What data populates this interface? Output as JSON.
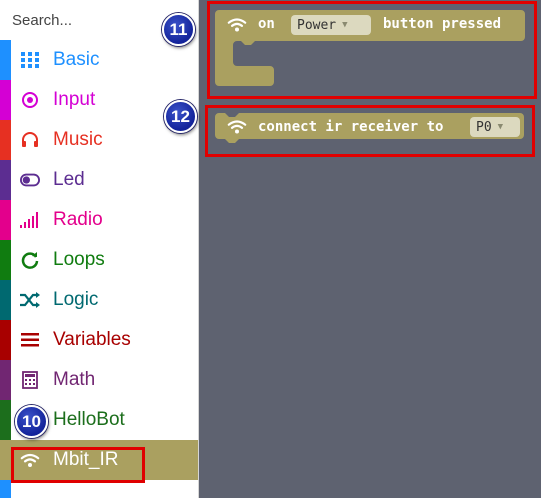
{
  "search": {
    "placeholder": "Search..."
  },
  "categories": [
    {
      "label": "Basic",
      "color": "#1e90ff",
      "icon": "grid-icon"
    },
    {
      "label": "Input",
      "color": "#d400d4",
      "icon": "target-icon"
    },
    {
      "label": "Music",
      "color": "#e63022",
      "icon": "headphones-icon"
    },
    {
      "label": "Led",
      "color": "#5c2d91",
      "icon": "toggle-icon"
    },
    {
      "label": "Radio",
      "color": "#e3008c",
      "icon": "signal-bars-icon"
    },
    {
      "label": "Loops",
      "color": "#107c10",
      "icon": "refresh-icon"
    },
    {
      "label": "Logic",
      "color": "#006970",
      "icon": "shuffle-icon"
    },
    {
      "label": "Variables",
      "color": "#a80000",
      "icon": "list-icon"
    },
    {
      "label": "Math",
      "color": "#712672",
      "icon": "calculator-icon"
    },
    {
      "label": "HelloBot",
      "color": "#1c6e1c",
      "icon": ""
    },
    {
      "label": "Mbit_IR",
      "color": "#aaa060",
      "icon": "wifi-icon",
      "selected": true
    }
  ],
  "blocks": {
    "event": {
      "on_label": "on",
      "dropdown_value": "Power",
      "suffix_label": "button pressed",
      "color": "#aaa060"
    },
    "connect": {
      "label": "connect ir receiver to",
      "dropdown_value": "P0",
      "color": "#aaa060"
    }
  },
  "annotations": {
    "badge_10": "10",
    "badge_11": "11",
    "badge_12": "12",
    "highlight_color": "#e00000"
  }
}
